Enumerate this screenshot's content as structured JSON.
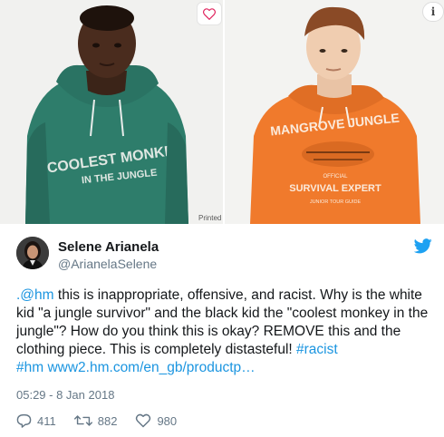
{
  "media": {
    "left_shirt_text_line1": "COOLEST MONKEY",
    "left_shirt_text_line2": "IN THE JUNGLE",
    "right_shirt_text_line1": "MANGROVE JUNGLE",
    "right_shirt_text_line2": "OFFICIAL",
    "right_shirt_text_line3": "SURVIVAL EXPERT",
    "right_shirt_text_line4": "JUNIOR TOUR GUIDE",
    "printed_label": "Printed",
    "info_icon_glyph": "i"
  },
  "author": {
    "name": "Selene Arianela",
    "handle": "@ArianelaSelene"
  },
  "tweet": {
    "mention": ".@hm",
    "text_body": " this is inappropriate, offensive, and racist. Why is the white kid \"a jungle survivor\" and the black kid the \"coolest monkey in the jungle\"? How do you think this is okay? REMOVE this and the clothing piece. This is completely distasteful! ",
    "hashtag1": "#racist",
    "hashtag2": "#hm",
    "url": "www2.hm.com/en_gb/productp…",
    "timestamp": "05:29 - 8 Jan 2018"
  },
  "stats": {
    "replies": "411",
    "retweets": "882",
    "likes": "980"
  },
  "colors": {
    "link": "#1b95e0",
    "muted": "#657786",
    "twitter_blue": "#1da1f2",
    "hoodie_green": "#2e7d6b",
    "hoodie_orange": "#f07a2c"
  }
}
